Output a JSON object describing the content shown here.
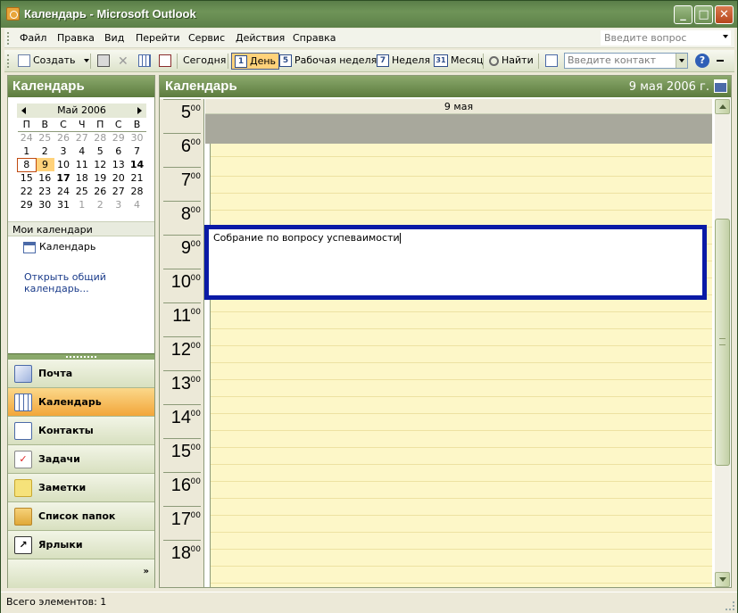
{
  "window": {
    "title": "Календарь - Microsoft Outlook"
  },
  "menu": {
    "items": [
      "Файл",
      "Правка",
      "Вид",
      "Перейти",
      "Сервис",
      "Действия",
      "Справка"
    ],
    "ask_placeholder": "Введите вопрос"
  },
  "toolbar": {
    "new_label": "Создать",
    "today_label": "Сегодня",
    "day_label": "День",
    "workweek_label": "Рабочая неделя",
    "week_label": "Неделя",
    "month_label": "Месяц",
    "find_label": "Найти",
    "contact_placeholder": "Введите контакт",
    "day_icon": "1",
    "workweek_icon": "5",
    "week_icon": "7",
    "month_icon": "31"
  },
  "nav": {
    "header": "Календарь",
    "minical": {
      "month_label": "Май 2006",
      "weekdays": [
        "П",
        "В",
        "С",
        "Ч",
        "П",
        "С",
        "В"
      ],
      "weeks": [
        [
          "24",
          "25",
          "26",
          "27",
          "28",
          "29",
          "30"
        ],
        [
          "1",
          "2",
          "3",
          "4",
          "5",
          "6",
          "7"
        ],
        [
          "8",
          "9",
          "10",
          "11",
          "12",
          "13",
          "14"
        ],
        [
          "15",
          "16",
          "17",
          "18",
          "19",
          "20",
          "21"
        ],
        [
          "22",
          "23",
          "24",
          "25",
          "26",
          "27",
          "28"
        ],
        [
          "29",
          "30",
          "31",
          "1",
          "2",
          "3",
          "4"
        ]
      ]
    },
    "my_calendars_header": "Мои календари",
    "calendar_item": "Календарь",
    "open_shared": "Открыть общий календарь...",
    "buttons": {
      "mail": "Почта",
      "calendar": "Календарь",
      "contacts": "Контакты",
      "tasks": "Задачи",
      "notes": "Заметки",
      "folders": "Список папок",
      "shortcuts": "Ярлыки"
    },
    "more_glyph": "»"
  },
  "main": {
    "header": "Календарь",
    "date": "9 мая 2006 г.",
    "day_column_label": "9 мая",
    "hours": [
      "5",
      "6",
      "7",
      "8",
      "9",
      "10",
      "11",
      "12",
      "13",
      "14",
      "15",
      "16",
      "17",
      "18"
    ],
    "minutes_label": "00",
    "appointment_text": "Собрание по вопросу успеваимости"
  },
  "status": {
    "text": "Всего элементов: 1"
  },
  "colors": {
    "title_bar": "#5a7e48",
    "slot_background": "#FDF7C8",
    "appointment_border": "#0a1aa6",
    "active_nav": "#f2a63a"
  }
}
